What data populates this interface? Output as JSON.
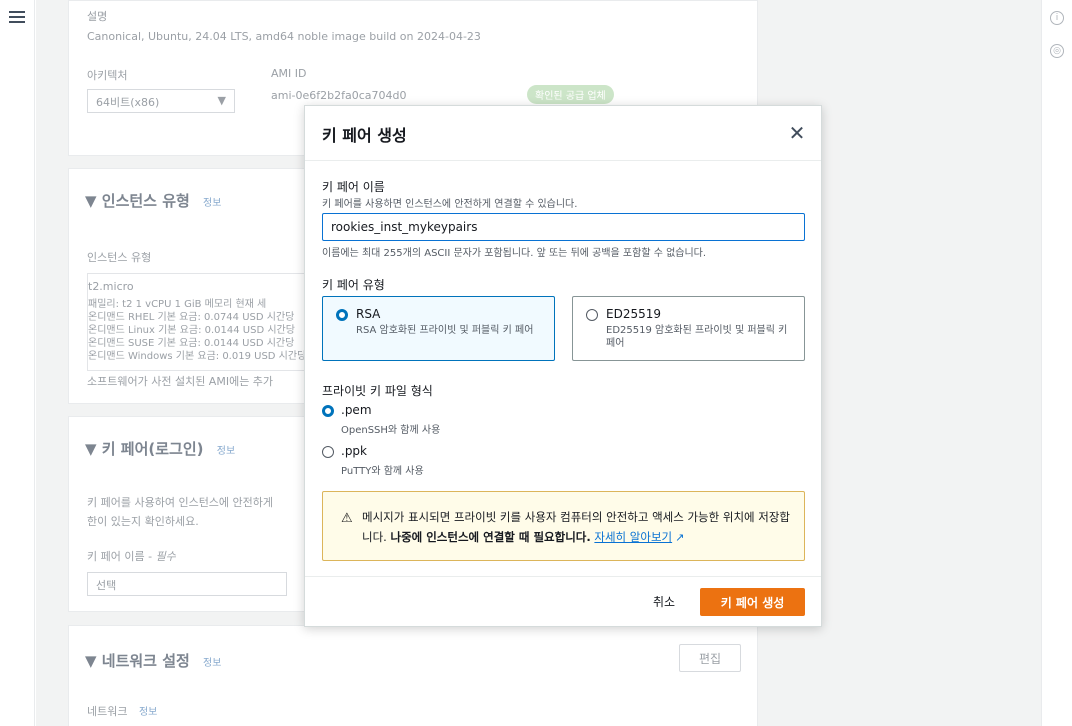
{
  "background": {
    "ami": {
      "desc_label": "설명",
      "desc_value": "Canonical, Ubuntu, 24.04 LTS, amd64 noble image build on 2024-04-23",
      "arch_label": "아키텍처",
      "arch_value": "64비트(x86)",
      "ami_id_label": "AMI ID",
      "ami_id_value": "ami-0e6f2b2fa0ca704d0",
      "verified_badge": "확인된 공급 업체"
    },
    "instance_type": {
      "title": "인스턴스 유형",
      "info": "정보",
      "field_label": "인스턴스 유형",
      "type_name": "t2.micro",
      "spec_line": "패밀리: t2    1 vCPU    1 GiB 메모리    현재 세",
      "price_lines": [
        "온디맨드 RHEL 기본 요금: 0.0744 USD 시간당",
        "온디맨드 Linux 기본 요금: 0.0144 USD 시간당",
        "온디맨드 SUSE 기본 요금: 0.0144 USD 시간당",
        "온디맨드 Windows 기본 요금: 0.019 USD 시간당"
      ],
      "footnote": "소프트웨어가 사전 설치된 AMI에는 추가"
    },
    "key_pair": {
      "title": "키 페어(로그인)",
      "info": "정보",
      "desc_line1": "키 페어를 사용하여 인스턴스에 안전하게",
      "desc_line2": "한이 있는지 확인하세요.",
      "field_label": "키 페어 이름 - ",
      "required": "필수",
      "select_placeholder": "선택"
    },
    "network": {
      "title": "네트워크 설정",
      "info": "정보",
      "edit_button": "편집",
      "network_label": "네트워크",
      "network_info": "정보"
    }
  },
  "modal": {
    "title": "키 페어 생성",
    "name_label": "키 페어 이름",
    "name_description": "키 페어를 사용하면 인스턴스에 안전하게 연결할 수 있습니다.",
    "name_value": "rookies_inst_mykeypairs",
    "name_constraint": "이름에는 최대 255개의 ASCII 문자가 포함됩니다. 앞 또는 뒤에 공백을 포함할 수 없습니다.",
    "type_label": "키 페어 유형",
    "types": [
      {
        "title": "RSA",
        "description": "RSA 암호화된 프라이빗 및 퍼블릭 키 페어",
        "selected": true
      },
      {
        "title": "ED25519",
        "description": "ED25519 암호화된 프라이빗 및 퍼블릭 키 페어",
        "selected": false
      }
    ],
    "format_label": "프라이빗 키 파일 형식",
    "formats": [
      {
        "title": ".pem",
        "description": "OpenSSH와 함께 사용",
        "selected": true
      },
      {
        "title": ".ppk",
        "description": "PuTTY와 함께 사용",
        "selected": false
      }
    ],
    "warning_text": "메시지가 표시되면 프라이빗 키를 사용자 컴퓨터의 안전하고 액세스 가능한 위치에 저장합니다. ",
    "warning_bold": "나중에 인스턴스에 연결할 때 필요합니다.",
    "warning_link": "자세히 알아보기",
    "cancel_label": "취소",
    "create_label": "키 페어 생성"
  }
}
